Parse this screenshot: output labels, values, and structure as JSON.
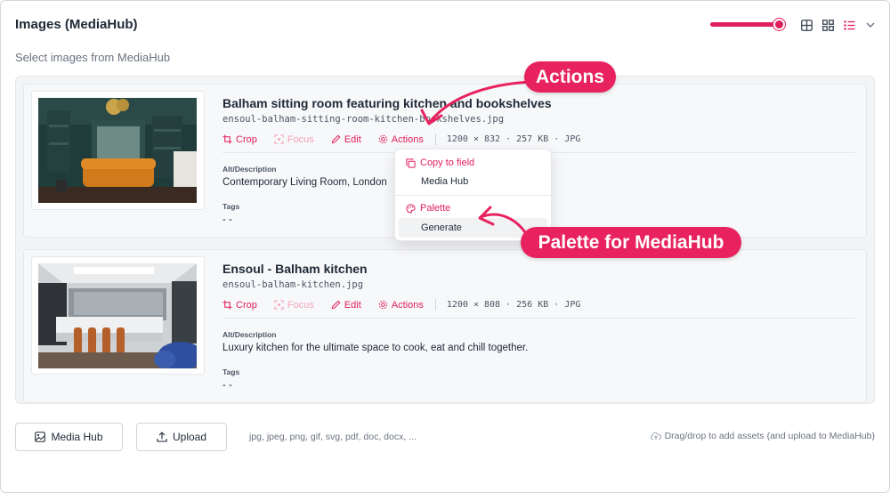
{
  "panel": {
    "title": "Images (MediaHub)",
    "subtitle": "Select images from MediaHub"
  },
  "toolbar": {
    "size_slider_value_percent": 100,
    "view_icons": [
      "grid-large-icon",
      "grid-small-icon",
      "list-icon",
      "chevron-down-icon"
    ]
  },
  "items": [
    {
      "title": "Balham sitting room featuring kitchen and bookshelves",
      "filename": "ensoul-balham-sitting-room-kitchen-bookshelves.jpg",
      "actions": {
        "crop": "Crop",
        "focus": "Focus",
        "edit": "Edit",
        "actions": "Actions"
      },
      "meta": "1200 × 832 · 257 KB · JPG",
      "alt_label": "Alt/Description",
      "alt_value": "Contemporary Living Room, London",
      "tags_label": "Tags",
      "tags_value": "- -"
    },
    {
      "title": "Ensoul - Balham kitchen",
      "filename": "ensoul-balham-kitchen.jpg",
      "actions": {
        "crop": "Crop",
        "focus": "Focus",
        "edit": "Edit",
        "actions": "Actions"
      },
      "meta": "1200 × 808 · 256 KB · JPG",
      "alt_label": "Alt/Description",
      "alt_value": "Luxury kitchen for the ultimate space to cook, eat and chill together.",
      "tags_label": "Tags",
      "tags_value": "- -"
    }
  ],
  "dropdown": {
    "copy_header": "Copy to field",
    "copy_item": "Media Hub",
    "palette_header": "Palette",
    "palette_item": "Generate"
  },
  "footer": {
    "mediahub_button": "Media Hub",
    "upload_button": "Upload",
    "formats": "jpg, jpeg, png, gif, svg, pdf, doc, docx, ...",
    "dragdrop": "Drag/drop to add assets (and upload to MediaHub)"
  },
  "callouts": {
    "actions": "Actions",
    "palette": "Palette for MediaHub"
  },
  "colors": {
    "accent": "#e11d5c",
    "callout": "#e8225f"
  }
}
